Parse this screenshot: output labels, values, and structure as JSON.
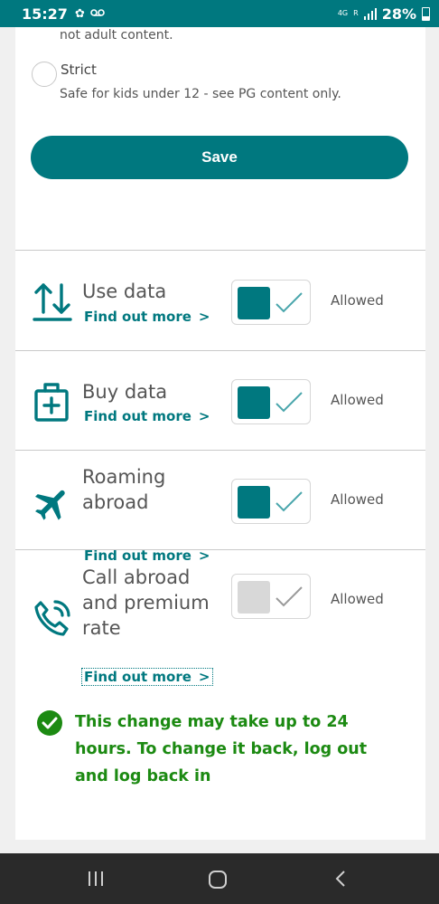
{
  "status_bar": {
    "time": "15:27",
    "network": "4G",
    "network_sub": "R",
    "battery": "28%"
  },
  "filter_options": {
    "partial_text": "not adult content.",
    "strict": {
      "title": "Strict",
      "description": "Safe for kids under 12 - see PG content only."
    }
  },
  "save_label": "Save",
  "settings": [
    {
      "title": "Use data",
      "link": "Find out more",
      "enabled": true,
      "status": "Allowed"
    },
    {
      "title": "Buy data",
      "link": "Find out more",
      "enabled": true,
      "status": "Allowed"
    },
    {
      "title": "Roaming abroad",
      "link": "Find out more",
      "enabled": true,
      "status": "Allowed"
    },
    {
      "title": "Call abroad and premium rate",
      "link": "Find out more",
      "enabled": false,
      "status": "Allowed"
    }
  ],
  "notice": "This change may take up to 24 hours. To change it back, log out and log back in",
  "colors": {
    "accent": "#00787f",
    "success": "#1c8a12",
    "toggle_off": "#d8d8d8"
  }
}
